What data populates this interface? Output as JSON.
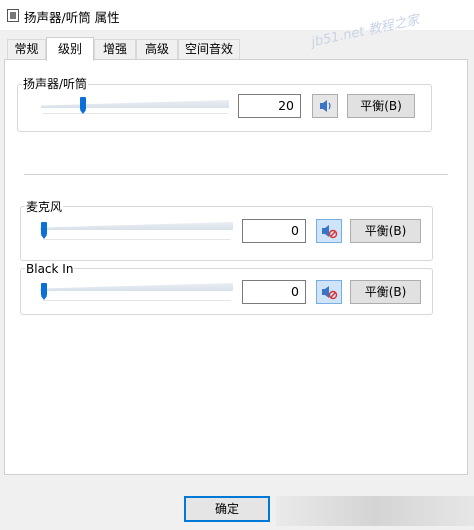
{
  "window": {
    "title": "扬声器/听筒 属性"
  },
  "tabs": [
    {
      "label": "常规"
    },
    {
      "label": "级别"
    },
    {
      "label": "增强"
    },
    {
      "label": "高级"
    },
    {
      "label": "空间音效"
    }
  ],
  "active_tab": "级别",
  "groups": [
    {
      "label": "扬声器/听筒",
      "value": "20",
      "level": 20,
      "muted": false,
      "balance_label": "平衡(B)"
    },
    {
      "label": "麦克风",
      "value": "0",
      "level": 0,
      "muted": true,
      "balance_label": "平衡(B)"
    },
    {
      "label": "Black In",
      "value": "0",
      "level": 0,
      "muted": true,
      "balance_label": "平衡(B)"
    }
  ],
  "footer": {
    "ok_label": "确定"
  },
  "icons": {
    "title": "speaker-properties-icon",
    "speaker": "speaker-icon",
    "muted": "speaker-muted-icon"
  },
  "colors": {
    "accent": "#0a6fd6",
    "muted_button_bg": "#cfe4f8",
    "mute_mark": "#e03030"
  }
}
